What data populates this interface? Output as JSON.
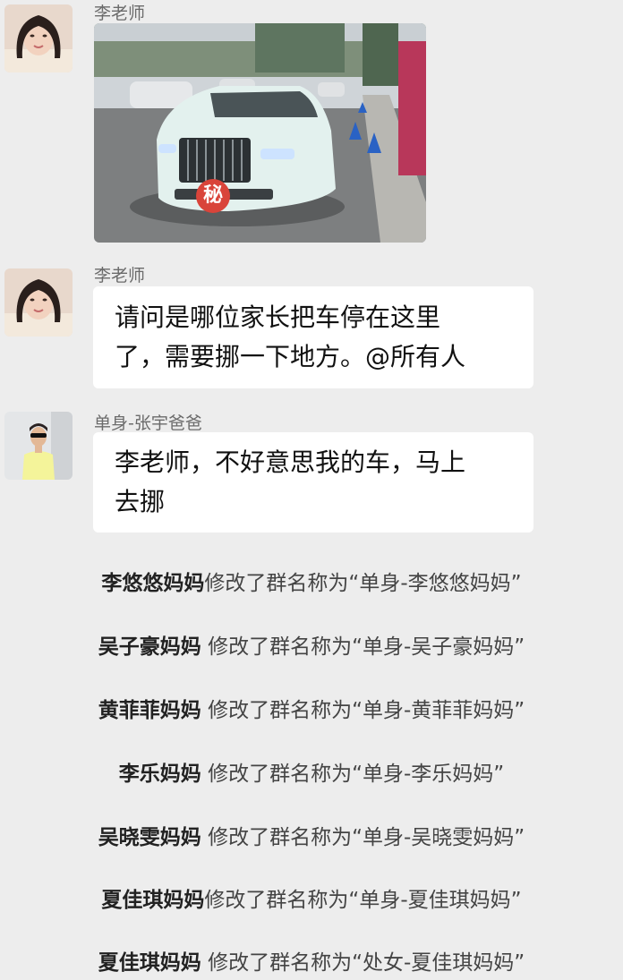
{
  "messages": [
    {
      "sender": "李老师",
      "type": "image",
      "badge": "秘"
    },
    {
      "sender": "李老师",
      "type": "text",
      "lines": [
        "请问是哪位家长把车停在这里",
        "了，需要挪一下地方。@所有人"
      ]
    },
    {
      "sender": "单身-张宇爸爸",
      "type": "text",
      "lines": [
        "李老师，不好意思我的车，马上",
        "去挪"
      ]
    }
  ],
  "system_notices": [
    {
      "nick": "李悠悠妈妈",
      "text": "修改了群名称为“单身-李悠悠妈妈”"
    },
    {
      "nick": "吴子豪妈妈",
      "text": " 修改了群名称为“单身-吴子豪妈妈”"
    },
    {
      "nick": "黄菲菲妈妈",
      "text": " 修改了群名称为“单身-黄菲菲妈妈”"
    },
    {
      "nick": "李乐妈妈",
      "text": " 修改了群名称为“单身-李乐妈妈”"
    },
    {
      "nick": "吴晓雯妈妈",
      "text": " 修改了群名称为“单身-吴晓雯妈妈”"
    },
    {
      "nick": "夏佳琪妈妈",
      "text": "修改了群名称为“单身-夏佳琪妈妈”"
    },
    {
      "nick": "夏佳琪妈妈",
      "text": " 修改了群名称为“处女-夏佳琪妈妈”"
    }
  ],
  "colors": {
    "background": "#ededed",
    "bubble": "#ffffff",
    "badge": "#d9443a"
  }
}
